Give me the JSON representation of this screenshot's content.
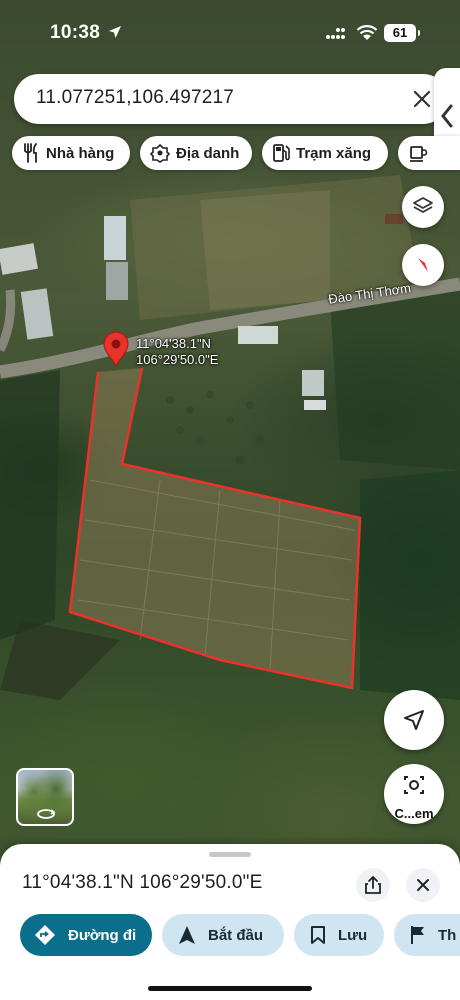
{
  "status_bar": {
    "time": "10:38",
    "battery": "61"
  },
  "search": {
    "value": "11.077251,106.497217"
  },
  "categories": [
    {
      "label": "Nhà hàng",
      "icon": "restaurant-icon"
    },
    {
      "label": "Địa danh",
      "icon": "landmark-icon"
    },
    {
      "label": "Trạm xăng",
      "icon": "gas-station-icon"
    },
    {
      "label": "",
      "icon": "coffee-icon"
    }
  ],
  "map": {
    "road_label": "Đào Thị Thơm",
    "pin": {
      "lat": "11°04'38.1\"N",
      "lng": "106°29'50.0\"E"
    },
    "boundary_color": "#e8322a",
    "camera_label": "C...em"
  },
  "sheet": {
    "title": "11°04'38.1\"N 106°29'50.0\"E",
    "actions": [
      {
        "label": "Đường đi",
        "icon": "directions-icon"
      },
      {
        "label": "Bắt đầu",
        "icon": "navigation-arrow-icon"
      },
      {
        "label": "Lưu",
        "icon": "bookmark-icon"
      },
      {
        "label": "Th",
        "icon": "flag-icon"
      }
    ]
  },
  "colors": {
    "primary": "#0b6e8a",
    "secondary": "#cfe5f1",
    "pin": "#e8322a"
  }
}
